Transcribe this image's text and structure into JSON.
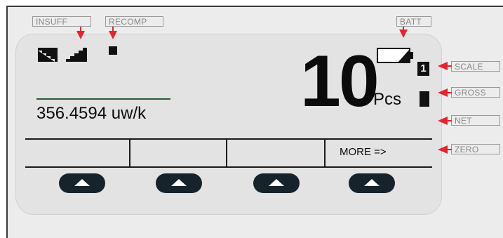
{
  "annotations": {
    "insuff": "INSUFF",
    "recomp": "RECOMP",
    "batt": "BATT",
    "scale": "SCALE",
    "gross": "GROSS",
    "net": "NET",
    "zero": "ZERO"
  },
  "display": {
    "main_value": "10",
    "main_unit": "Pcs",
    "scale_number": "1",
    "apw": "356.4594 uw/k"
  },
  "softkeys": {
    "labels": [
      "",
      "",
      "",
      "MORE =>"
    ]
  },
  "colors": {
    "arrow": "#e8222e",
    "panel": "#e3e3e3",
    "button": "#16232b"
  }
}
